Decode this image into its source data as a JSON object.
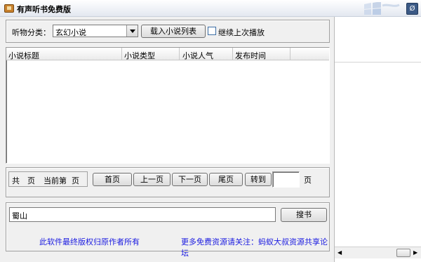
{
  "window": {
    "title": "有声听书免费版",
    "close_glyph": "Ø"
  },
  "category": {
    "label": "听物分类：",
    "selected": "玄幻小说",
    "load_button": "载入小说列表",
    "continue_label": "继续上次播放"
  },
  "table": {
    "headers": [
      "小说标题",
      "小说类型",
      "小说人气",
      "发布时间"
    ],
    "rows": []
  },
  "pagination": {
    "total_label": "共",
    "total_unit": "页",
    "current_label": "当前第",
    "current_unit": "页",
    "first": "首页",
    "prev": "上一页",
    "next": "下一页",
    "last": "尾页",
    "goto": "转到",
    "goto_value": "",
    "goto_unit": "页"
  },
  "search": {
    "value": "蜀山",
    "button": "搜书"
  },
  "footer": {
    "copyright": "此软件最终版权归原作者所有",
    "promo": "更多免费资源请关注：蚂蚁大叔资源共享论坛"
  },
  "icons": {
    "app": "book-icon",
    "logo": "windows-flag-icon",
    "dropdown": "chevron-down-icon",
    "hscroll": "scroll-grip-icon"
  }
}
